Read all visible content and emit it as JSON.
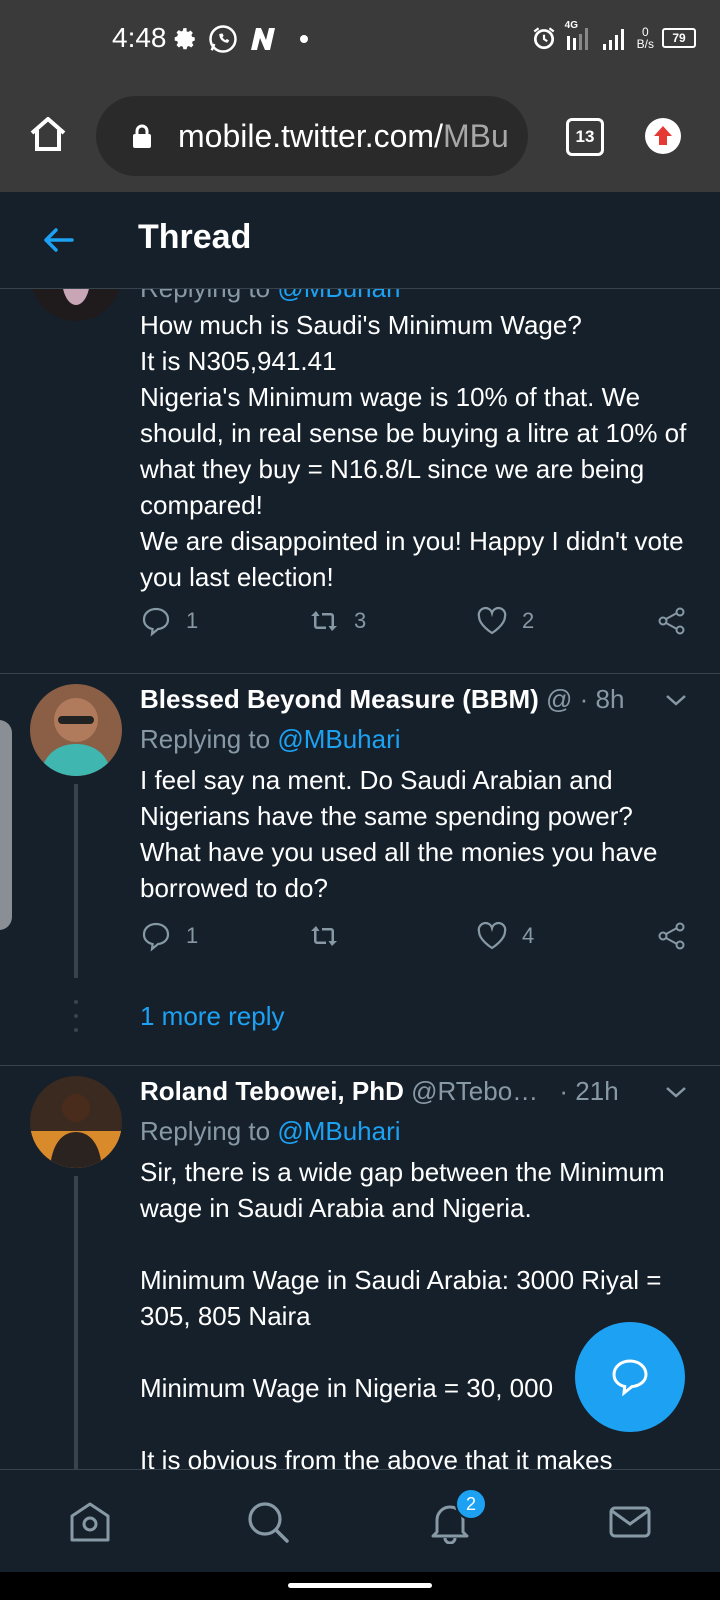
{
  "status_bar": {
    "time": "4:48",
    "network_type": "4G",
    "speed_value": "0",
    "speed_unit": "B/s",
    "battery": "79"
  },
  "browser": {
    "url_main": "mobile.twitter.com/",
    "url_dim": "MBu",
    "tab_count": "13"
  },
  "app_bar": {
    "title": "Thread"
  },
  "tweets": [
    {
      "replying_label": "Replying to ",
      "replying_handle": "@MBuhari",
      "body": "How much is Saudi's Minimum Wage?\nIt is N305,941.41\nNigeria's Minimum wage is 10% of that. We should, in real sense be buying a litre at 10% of what they buy =  N16.8/L since we are being compared!\nWe are disappointed in you! Happy I didn't vote you last election!",
      "replies": "1",
      "retweets": "3",
      "likes": "2"
    },
    {
      "name": "Blessed Beyond Measure (BBM)",
      "handle": "@",
      "time": "· 8h",
      "replying_label": "Replying to ",
      "replying_handle": "@MBuhari",
      "body": "I feel say na ment. Do Saudi Arabian and Nigerians have the same spending power? What have you used all the monies you have borrowed to do?",
      "replies": "1",
      "retweets": "",
      "likes": "4",
      "more_replies": "1 more reply"
    },
    {
      "name": "Roland Tebowei, PhD",
      "handle": "@RTebo…",
      "time": "· 21h",
      "replying_label": "Replying to ",
      "replying_handle": "@MBuhari",
      "body": "Sir, there is a wide gap between the Minimum wage in Saudi Arabia and Nigeria.\n\nMinimum Wage in Saudi Arabia: 3000 Riyal = 305, 805 Naira\n\nMinimum Wage in Nigeria = 30, 000\n\nIt is obvious from the above that it makes"
    }
  ],
  "bottom_nav": {
    "notifications_badge": "2"
  },
  "colors": {
    "background": "#15202b",
    "accent": "#1da1f2",
    "muted": "#8899a6"
  }
}
